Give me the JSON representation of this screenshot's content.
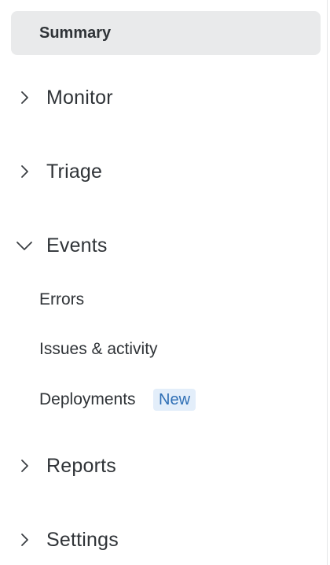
{
  "nav": {
    "summary": {
      "label": "Summary"
    },
    "sections": [
      {
        "label": "Monitor",
        "expanded": false,
        "icon": "chevron-right-icon"
      },
      {
        "label": "Triage",
        "expanded": false,
        "icon": "chevron-right-icon"
      },
      {
        "label": "Events",
        "expanded": true,
        "icon": "chevron-down-icon"
      },
      {
        "label": "Reports",
        "expanded": false,
        "icon": "chevron-right-icon"
      },
      {
        "label": "Settings",
        "expanded": false,
        "icon": "chevron-right-icon"
      }
    ],
    "events_items": [
      {
        "label": "Errors"
      },
      {
        "label": "Issues & activity"
      },
      {
        "label": "Deployments",
        "badge": "New"
      }
    ]
  },
  "colors": {
    "active_bg": "#e9eaeb",
    "text": "#2f3337",
    "badge_bg": "#e3eefa",
    "badge_text": "#2f6fb5"
  }
}
